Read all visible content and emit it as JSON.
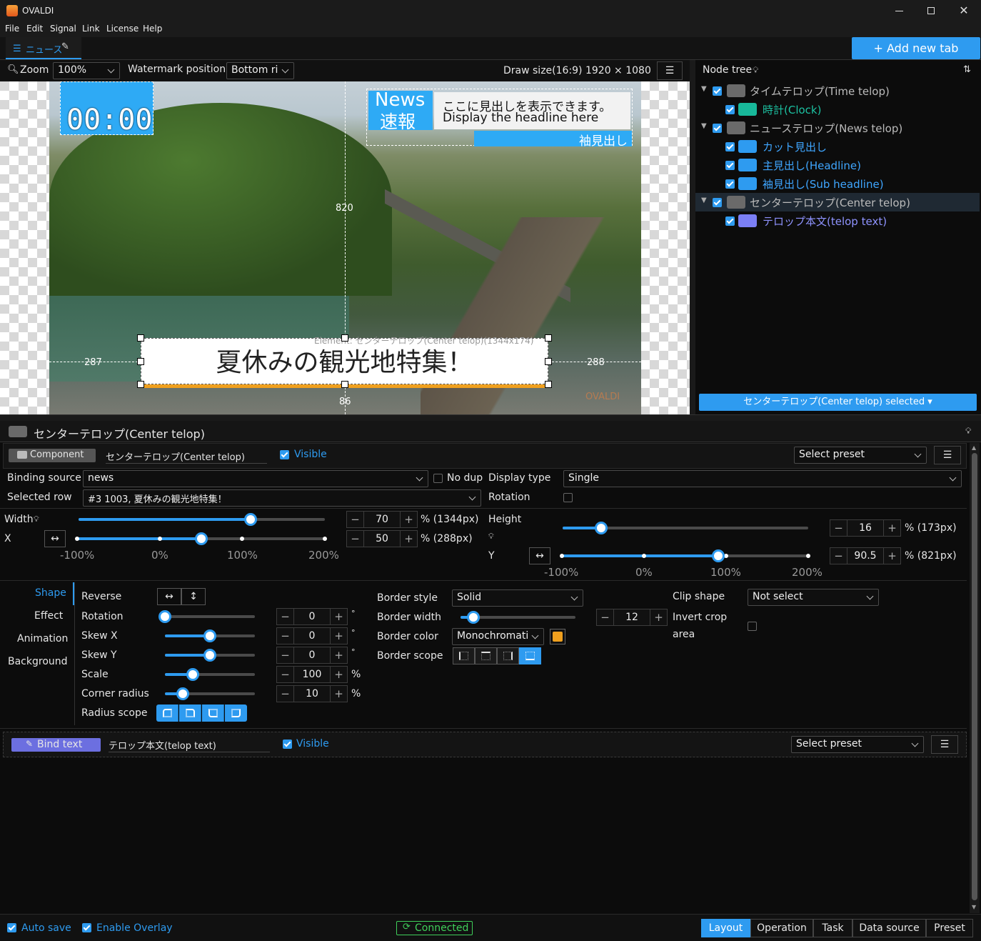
{
  "app": {
    "title": "OVALDI"
  },
  "menu": [
    "File",
    "Edit",
    "Signal",
    "Link",
    "License",
    "Help"
  ],
  "tabs": {
    "current": "ニュース",
    "add_label": "+ Add new tab"
  },
  "toolbar": {
    "zoom_label": "Zoom",
    "zoom_value": "100%",
    "watermark_label": "Watermark position",
    "watermark_value": "Bottom ri",
    "draw_size": "Draw size(16:9)  1920 × 1080"
  },
  "preview": {
    "clock": "00:00",
    "news_badge_1": "News",
    "news_badge_2": "速報",
    "headline_jp": "ここに見出しを表示できます。",
    "headline_en": "Display the headline here",
    "sub_headline": "袖見出し",
    "center_text": "夏休みの観光地特集！",
    "element_label": "Element: センターテロップ(Center telop)(1344x174)",
    "measure_top": "820",
    "measure_left": "287",
    "measure_right": "288",
    "measure_bottom": "86",
    "watermark": "OVALDI"
  },
  "node_tree": {
    "title": "Node tree",
    "items": [
      {
        "label": "タイムテロップ(Time telop)",
        "kind": "component",
        "level": 0
      },
      {
        "label": "時計(Clock)",
        "kind": "clock",
        "level": 1
      },
      {
        "label": "ニューステロップ(News telop)",
        "kind": "component",
        "level": 0
      },
      {
        "label": "カット見出し",
        "kind": "text",
        "level": 1
      },
      {
        "label": "主見出し(Headline)",
        "kind": "text",
        "level": 1
      },
      {
        "label": "袖見出し(Sub headline)",
        "kind": "text",
        "level": 1
      },
      {
        "label": "センターテロップ(Center telop)",
        "kind": "component",
        "level": 0
      },
      {
        "label": "テロップ本文(telop text)",
        "kind": "text",
        "level": 1
      }
    ],
    "selected_button": "センターテロップ(Center telop) selected ▾"
  },
  "props": {
    "header_title": "センターテロップ(Center telop)",
    "component_tab": "Component",
    "component_name": "センターテロップ(Center telop)",
    "visible_label": "Visible",
    "select_preset": "Select preset",
    "binding_source_label": "Binding source",
    "binding_source_value": "news",
    "no_dup_label": "No dup",
    "display_type_label": "Display type",
    "display_type_value": "Single",
    "selected_row_label": "Selected row",
    "selected_row_value": "#3 1003, 夏休みの観光地特集！",
    "rotation_label": "Rotation",
    "width_label": "Width",
    "width_value": "70",
    "width_unit": "% (1344px)",
    "width_pct": 70,
    "x_label": "X",
    "x_value": "50",
    "x_unit": "% (288px)",
    "height_label": "Height",
    "height_value": "16",
    "height_unit": "% (173px)",
    "y_label": "Y",
    "y_value": "90.5",
    "y_unit": "% (821px)",
    "scale_ticks": [
      "-100%",
      "0%",
      "100%",
      "200%"
    ]
  },
  "shape": {
    "side_tabs": [
      "Shape",
      "Effect",
      "Animation",
      "Background"
    ],
    "reverse_label": "Reverse",
    "rows": [
      {
        "label": "Rotation",
        "value": "0",
        "unit": "°"
      },
      {
        "label": "Skew X",
        "value": "0",
        "unit": "°"
      },
      {
        "label": "Skew Y",
        "value": "0",
        "unit": "°"
      },
      {
        "label": "Scale",
        "value": "100",
        "unit": "%"
      },
      {
        "label": "Corner radius",
        "value": "10",
        "unit": "%"
      }
    ],
    "radius_scope_label": "Radius scope",
    "border_style_label": "Border style",
    "border_style_value": "Solid",
    "border_width_label": "Border width",
    "border_width_value": "12",
    "border_color_label": "Border color",
    "border_color_value": "Monochromati",
    "border_color_swatch": "#f0a01e",
    "border_scope_label": "Border scope",
    "clip_shape_label": "Clip shape",
    "clip_shape_value": "Not select",
    "invert_crop_label_1": "Invert crop",
    "invert_crop_label_2": "area"
  },
  "bind_text": {
    "tab": "Bind text",
    "name": "テロップ本文(telop text)",
    "visible_label": "Visible",
    "select_preset": "Select preset"
  },
  "statusbar": {
    "auto_save": "Auto save",
    "enable_overlay": "Enable Overlay",
    "connected": "Connected",
    "modes": [
      "Layout",
      "Operation",
      "Task",
      "Data source",
      "Preset"
    ],
    "active_mode": "Layout"
  },
  "colors": {
    "accent": "#2e9bf0",
    "connected": "#3fcf5a",
    "orange": "#f0a01e"
  }
}
